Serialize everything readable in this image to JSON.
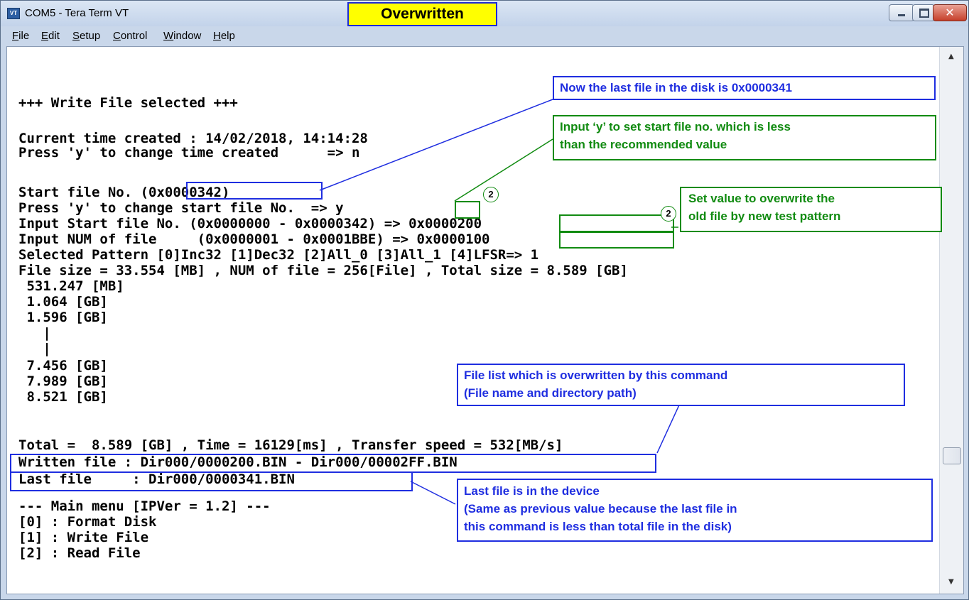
{
  "window": {
    "app_icon_text": "VT",
    "title": "COM5 - Tera Term VT",
    "overlay_title": "Overwritten",
    "close_glyph": "✕"
  },
  "menu": [
    "File",
    "Edit",
    "Setup",
    "Control",
    "Window",
    "Help"
  ],
  "terminal_lines": [
    "",
    "+++ Write File selected +++",
    "",
    "Current time created : 14/02/2018, 14:14:28",
    "Press 'y' to change time created      => n",
    "",
    "Start file No. (0x0000342)",
    "Press 'y' to change start file No.  => y",
    "Input Start file No. (0x0000000 - 0x0000342) => 0x0000200",
    "Input NUM of file     (0x0000001 - 0x0001BBE) => 0x0000100",
    "Selected Pattern [0]Inc32 [1]Dec32 [2]All_0 [3]All_1 [4]LFSR=> 1",
    "File size = 33.554 [MB] , NUM of file = 256[File] , Total size = 8.589 [GB]",
    " 531.247 [MB]",
    " 1.064 [GB]",
    " 1.596 [GB]",
    "   |",
    "   |",
    " 7.456 [GB]",
    " 7.989 [GB]",
    " 8.521 [GB]",
    "",
    "Total =  8.589 [GB] , Time = 16129[ms] , Transfer speed = 532[MB/s]",
    "Written file : Dir000/0000200.BIN - Dir000/00002FF.BIN",
    "Last file     : Dir000/0000341.BIN",
    "",
    "--- Main menu [IPVer = 1.2] ---",
    "[0] : Format Disk",
    "[1] : Write File",
    "[2] : Read File"
  ],
  "callouts": {
    "last_file_note": "Now the last file in the disk is 0x0000341",
    "input_y_line1": "Input ‘y’ to set start file no. which is less",
    "input_y_line2": "than the recommended value",
    "set_value_line1": "Set value to overwrite the",
    "set_value_line2": "old file by new test pattern",
    "file_list_line1": "File list which is overwritten by this command",
    "file_list_line2": "(File name and directory path)",
    "last_device_line1": "Last file is in the device",
    "last_device_line2": "(Same as previous value because the last file in",
    "last_device_line3": "this command is less than total file in the disk)"
  },
  "markers": [
    "2",
    "2"
  ],
  "scrollbar": {
    "up_glyph": "▲",
    "down_glyph": "▼"
  },
  "colors": {
    "callout_blue": "#1f2ee0",
    "callout_green": "#118b11",
    "overlay_yellow": "#ffff00"
  }
}
